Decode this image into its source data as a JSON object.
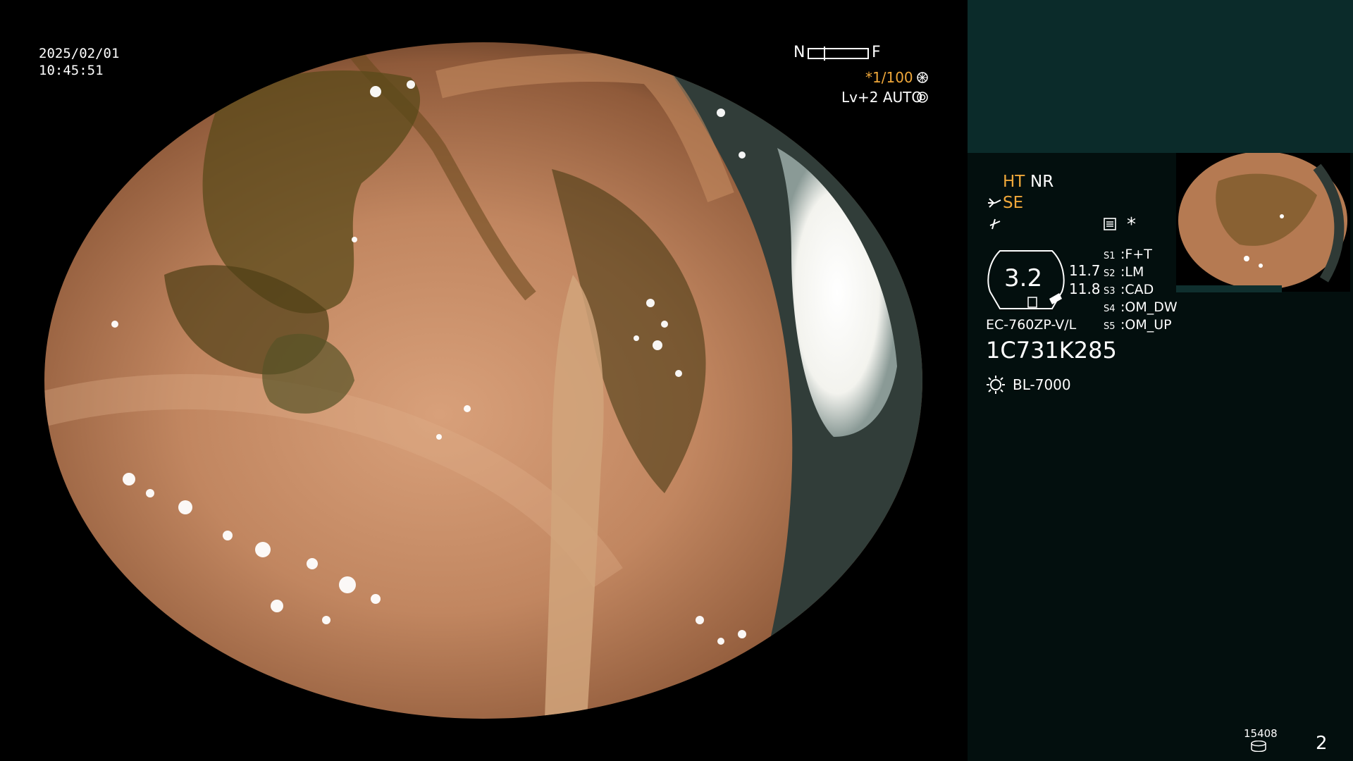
{
  "overlay": {
    "date": "2025/02/01",
    "time": "10:45:51",
    "focus": {
      "near": "N",
      "far": "F",
      "level": 0.25
    },
    "shutter": "*1/100",
    "shutter_icon": "aperture-icon",
    "exposure": "Lv+2 AUTO",
    "exposure_icon": "iris-icon"
  },
  "panel": {
    "mode_ht": "HT",
    "mode_nr": "NR",
    "mode_se": "SE",
    "mode_se_icon": "scope-tip-icon",
    "freeze_icon": "freeze-icon",
    "settings_icon": "settings-icon",
    "asterisk": "*",
    "zoom_value": "3.2",
    "readout_1": "11.7",
    "readout_2": "11.8",
    "scope_model": "EC-760ZP-V/L",
    "serial": "1C731K285",
    "light_icon": "sun-icon",
    "light_source": "BL-7000",
    "switches": [
      {
        "key": "S1",
        "value": "F+T"
      },
      {
        "key": "S2",
        "value": "LM"
      },
      {
        "key": "S3",
        "value": "CAD"
      },
      {
        "key": "S4",
        "value": "OM_DW"
      },
      {
        "key": "S5",
        "value": "OM_UP"
      }
    ],
    "storage_count": "15408",
    "storage_icon": "disk-icon",
    "page_number": "2"
  },
  "colors": {
    "accent": "#f0a83a",
    "panel_bg": "#030f0e",
    "panel_top": "#0b2b2a"
  }
}
